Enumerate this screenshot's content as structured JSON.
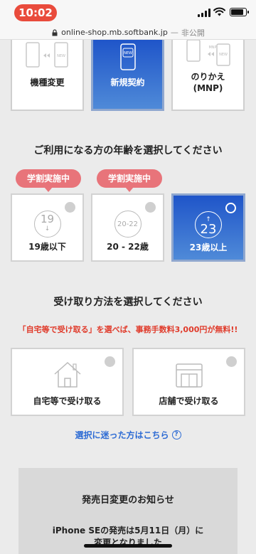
{
  "status": {
    "time": "10:02"
  },
  "browser": {
    "url": "online-shop.mb.softbank.jp",
    "separator": "—",
    "privacy": "非公開"
  },
  "contract": {
    "options": [
      {
        "label": "機種変更"
      },
      {
        "label": "新規契約",
        "selected": true,
        "icon_text": "NEW"
      },
      {
        "label_line1": "のりかえ",
        "label_line2": "(MNP)",
        "icon_text1": "MNP",
        "icon_text2": "NEW"
      }
    ],
    "phone_icon_new": "NEW"
  },
  "age_section": {
    "title": "ご利用になる方の年齢を選択してください",
    "badge": "学割実施中",
    "options": [
      {
        "number": "19",
        "label": "19歳以下",
        "arrow": "↓"
      },
      {
        "number": "20-22",
        "label": "20 - 22歳"
      },
      {
        "number": "23",
        "label": "23歳以上",
        "arrow": "↑",
        "selected": true
      }
    ]
  },
  "delivery": {
    "title": "受け取り方法を選択してください",
    "note": "「自宅等で受け取る」を選べば、事務手数料3,000円が無料!!",
    "options": [
      {
        "label": "自宅等で受け取る",
        "icon": "house-icon"
      },
      {
        "label": "店舗で受け取る",
        "icon": "store-icon"
      }
    ],
    "help": "選択に迷った方はこちら",
    "help_icon": "?"
  },
  "notice": {
    "title": "発売日変更のお知らせ",
    "line1": "iPhone SEの発売は5月11日（月）に",
    "line2": "変更となりました"
  },
  "colors": {
    "accent": "#1f55c9",
    "badge": "#e8747a",
    "note": "#e03b2b",
    "link": "#2d6bd4"
  }
}
